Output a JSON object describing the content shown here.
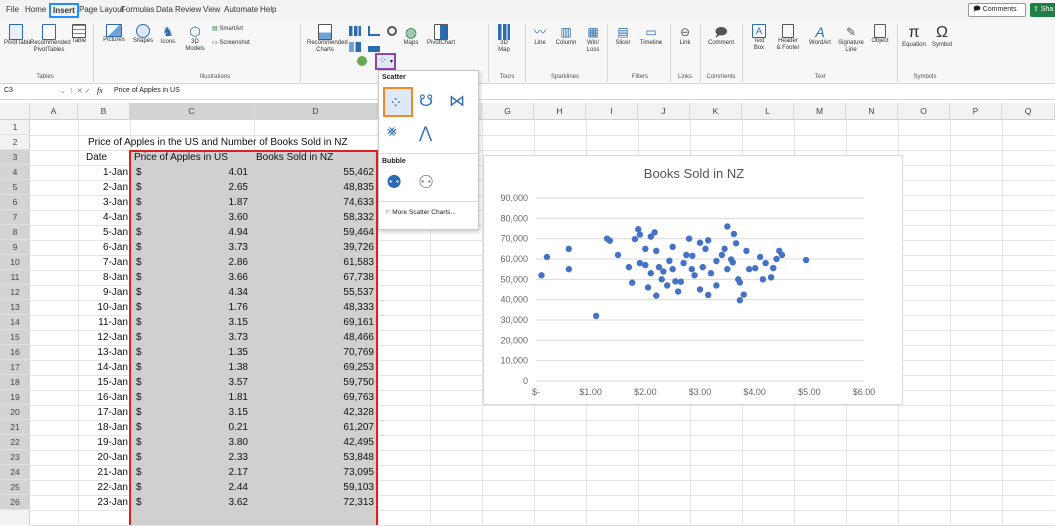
{
  "menu": {
    "items": [
      "File",
      "Home",
      "Insert",
      "Page Layout",
      "Formulas",
      "Data",
      "Review",
      "View",
      "Automate",
      "Help"
    ],
    "comments_label": "Comments",
    "share_label": "Sha"
  },
  "ribbon": {
    "tables": {
      "pivottable": "PivotTable",
      "recommended": "Recommended",
      "recommended2": "PivotTables",
      "table": "Table",
      "group": "Tables"
    },
    "illustrations": {
      "pictures": "Pictures",
      "shapes": "Shapes",
      "icons": "Icons",
      "models": "3D",
      "models2": "Models",
      "smartart": "SmartArt",
      "screenshot": "Screenshot",
      "group": "Illustrations"
    },
    "charts": {
      "recommended": "Recommended",
      "recommended2": "Charts",
      "maps": "Maps",
      "pivotchart": "PivotChart"
    },
    "tours": {
      "map3d": "3D",
      "map3d2": "Map",
      "group": "Tours"
    },
    "sparklines": {
      "line": "Line",
      "column": "Column",
      "winloss": "Win/",
      "winloss2": "Loss",
      "group": "Sparklines"
    },
    "filters": {
      "slicer": "Slicer",
      "timeline": "Timeline",
      "group": "Filters"
    },
    "links": {
      "link": "Link",
      "group": "Links"
    },
    "comments": {
      "comment": "Comment",
      "group": "Comments"
    },
    "text": {
      "textbox": "Text",
      "textbox2": "Box",
      "header": "Header",
      "header2": "& Footer",
      "wordart": "WordArt",
      "signature": "Signature",
      "signature2": "Line",
      "object": "Object",
      "group": "Text"
    },
    "symbols": {
      "equation": "Equation",
      "symbol": "Symbol",
      "group": "Symbols"
    }
  },
  "formula_bar": {
    "name_box": "C3",
    "fx": "fx",
    "content": "Price of Apples in US"
  },
  "columns": [
    "A",
    "B",
    "C",
    "D",
    "E",
    "F",
    "G",
    "H",
    "I",
    "J",
    "K",
    "L",
    "M",
    "N",
    "O",
    "P",
    "Q"
  ],
  "rows": [
    "1",
    "2",
    "3",
    "4",
    "5",
    "6",
    "7",
    "8",
    "9",
    "10",
    "11",
    "12",
    "13",
    "14",
    "15",
    "16",
    "17",
    "18",
    "19",
    "20",
    "21",
    "22",
    "23",
    "24",
    "25",
    "26"
  ],
  "sheet": {
    "title": "Price of Apples in the US and Number of Books Sold in NZ",
    "header_date": "Date",
    "header_price": "Price of Apples in US",
    "header_books": "Books Sold in NZ",
    "currency": "$",
    "data": [
      [
        "1-Jan",
        "4.01",
        "55,462"
      ],
      [
        "2-Jan",
        "2.65",
        "48,835"
      ],
      [
        "3-Jan",
        "1.87",
        "74,633"
      ],
      [
        "4-Jan",
        "3.60",
        "58,332"
      ],
      [
        "5-Jan",
        "4.94",
        "59,464"
      ],
      [
        "6-Jan",
        "3.73",
        "39,726"
      ],
      [
        "7-Jan",
        "2.86",
        "61,583"
      ],
      [
        "8-Jan",
        "3.66",
        "67,738"
      ],
      [
        "9-Jan",
        "4.34",
        "55,537"
      ],
      [
        "10-Jan",
        "1.76",
        "48,333"
      ],
      [
        "11-Jan",
        "3.15",
        "69,161"
      ],
      [
        "12-Jan",
        "3.73",
        "48,466"
      ],
      [
        "13-Jan",
        "1.35",
        "70,769"
      ],
      [
        "14-Jan",
        "1.38",
        "69,253"
      ],
      [
        "15-Jan",
        "3.57",
        "59,750"
      ],
      [
        "16-Jan",
        "1.81",
        "69,763"
      ],
      [
        "17-Jan",
        "3.15",
        "42,328"
      ],
      [
        "18-Jan",
        "0.21",
        "61,207"
      ],
      [
        "19-Jan",
        "3.80",
        "42,495"
      ],
      [
        "20-Jan",
        "2.33",
        "53,848"
      ],
      [
        "21-Jan",
        "2.17",
        "73,095"
      ],
      [
        "22-Jan",
        "2.44",
        "59,103"
      ],
      [
        "23-Jan",
        "3.62",
        "72,313"
      ]
    ]
  },
  "dropdown": {
    "section_scatter": "Scatter",
    "section_bubble": "Bubble",
    "more": "More Scatter Charts..."
  },
  "chart_data": {
    "type": "scatter",
    "title": "Books Sold in NZ",
    "x_ticks": [
      "$-",
      "$1.00",
      "$2.00",
      "$3.00",
      "$4.00",
      "$5.00",
      "$6.00"
    ],
    "y_ticks": [
      "0",
      "10,000",
      "20,000",
      "30,000",
      "40,000",
      "50,000",
      "60,000",
      "70,000",
      "80,000",
      "90,000"
    ],
    "xlim": [
      0,
      6
    ],
    "ylim": [
      0,
      90000
    ],
    "grid": true,
    "color": "#4472c4",
    "points": [
      [
        0.1,
        52000
      ],
      [
        0.2,
        61000
      ],
      [
        0.6,
        65000
      ],
      [
        0.6,
        55000
      ],
      [
        1.1,
        32000
      ],
      [
        1.3,
        70000
      ],
      [
        1.35,
        69000
      ],
      [
        1.5,
        62000
      ],
      [
        1.7,
        56000
      ],
      [
        1.76,
        48333
      ],
      [
        1.81,
        69763
      ],
      [
        1.87,
        74633
      ],
      [
        1.9,
        72000
      ],
      [
        1.9,
        58000
      ],
      [
        2.0,
        65000
      ],
      [
        2.0,
        57000
      ],
      [
        2.05,
        46000
      ],
      [
        2.1,
        71000
      ],
      [
        2.1,
        53000
      ],
      [
        2.17,
        73095
      ],
      [
        2.2,
        64000
      ],
      [
        2.2,
        42000
      ],
      [
        2.25,
        56000
      ],
      [
        2.3,
        50000
      ],
      [
        2.33,
        53848
      ],
      [
        2.4,
        47000
      ],
      [
        2.44,
        59103
      ],
      [
        2.5,
        66000
      ],
      [
        2.5,
        55000
      ],
      [
        2.55,
        49000
      ],
      [
        2.6,
        44000
      ],
      [
        2.65,
        48835
      ],
      [
        2.7,
        58000
      ],
      [
        2.75,
        62000
      ],
      [
        2.8,
        70000
      ],
      [
        2.85,
        55000
      ],
      [
        2.86,
        61583
      ],
      [
        2.9,
        52000
      ],
      [
        3.0,
        68000
      ],
      [
        3.0,
        45000
      ],
      [
        3.05,
        56000
      ],
      [
        3.1,
        65000
      ],
      [
        3.15,
        69161
      ],
      [
        3.15,
        42328
      ],
      [
        3.2,
        53000
      ],
      [
        3.3,
        59000
      ],
      [
        3.3,
        47000
      ],
      [
        3.4,
        62000
      ],
      [
        3.45,
        65000
      ],
      [
        3.5,
        55000
      ],
      [
        3.5,
        76000
      ],
      [
        3.57,
        59750
      ],
      [
        3.6,
        58332
      ],
      [
        3.62,
        72313
      ],
      [
        3.66,
        67738
      ],
      [
        3.7,
        50000
      ],
      [
        3.73,
        39726
      ],
      [
        3.73,
        48466
      ],
      [
        3.8,
        42495
      ],
      [
        3.85,
        64000
      ],
      [
        3.9,
        55000
      ],
      [
        4.01,
        55462
      ],
      [
        4.1,
        61000
      ],
      [
        4.15,
        50000
      ],
      [
        4.2,
        58000
      ],
      [
        4.3,
        51000
      ],
      [
        4.34,
        55537
      ],
      [
        4.4,
        60000
      ],
      [
        4.45,
        64000
      ],
      [
        4.5,
        62000
      ],
      [
        4.94,
        59464
      ]
    ]
  }
}
